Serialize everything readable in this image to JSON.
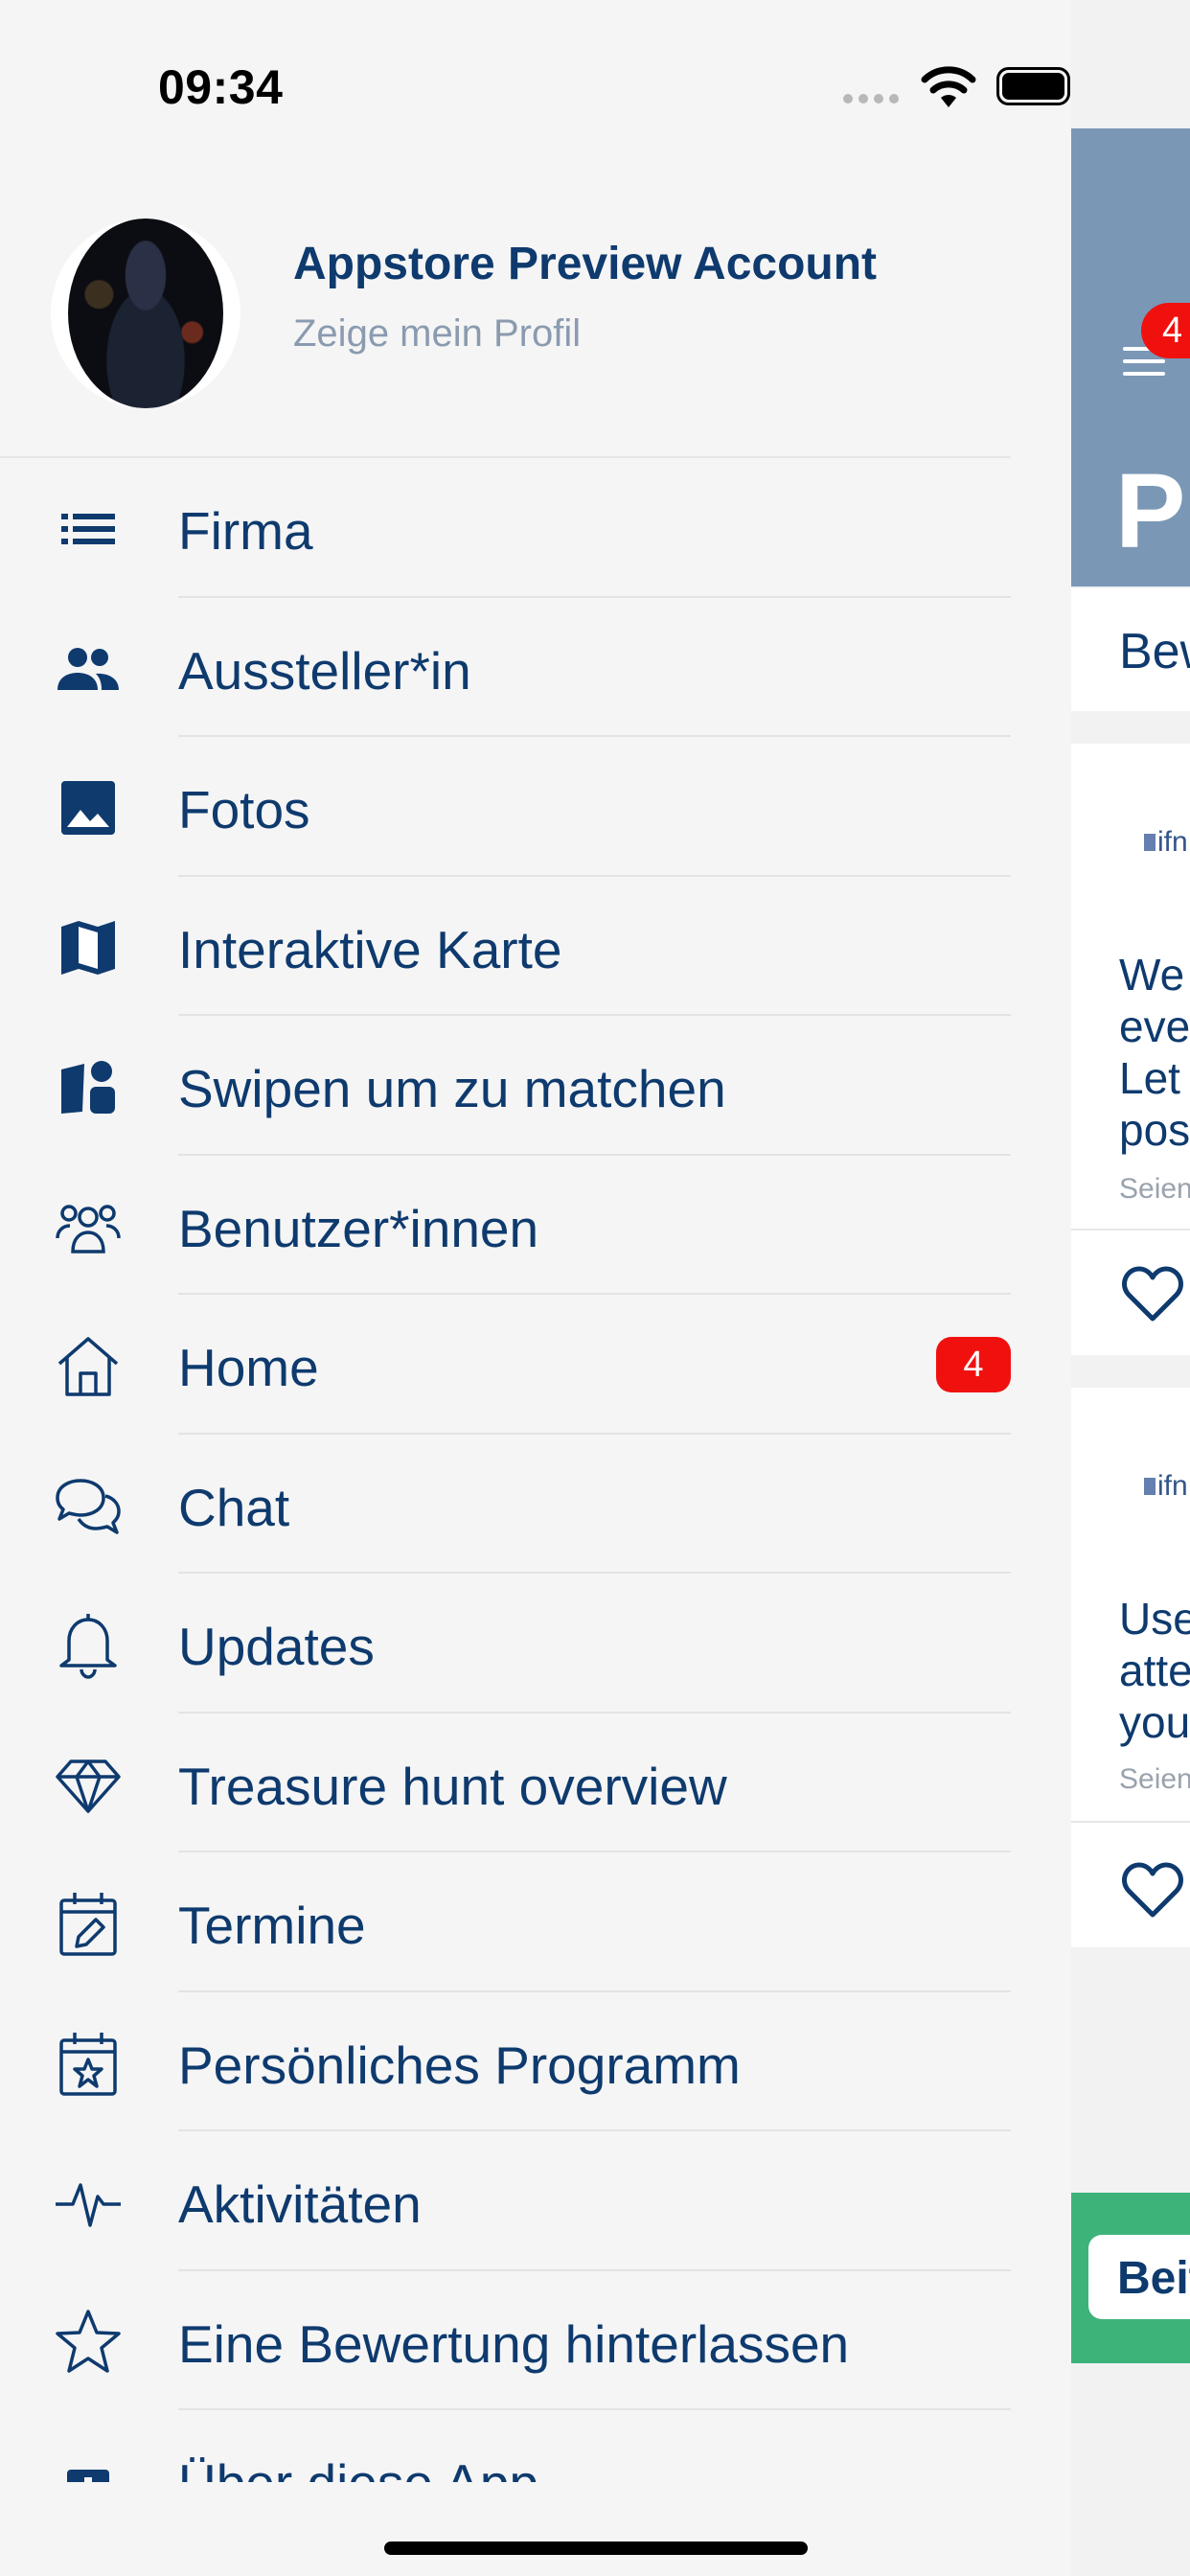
{
  "status_bar": {
    "time": "09:34"
  },
  "drawer": {
    "user_name": "Appstore Preview Account",
    "profile_link": "Zeige mein Profil",
    "items": [
      {
        "label": "Firma",
        "icon": "list-icon"
      },
      {
        "label": "Aussteller*in",
        "icon": "people-icon"
      },
      {
        "label": "Fotos",
        "icon": "photo-icon"
      },
      {
        "label": "Interaktive Karte",
        "icon": "map-icon"
      },
      {
        "label": "Swipen um zu matchen",
        "icon": "swipe-match-icon"
      },
      {
        "label": "Benutzer*innen",
        "icon": "users-icon"
      },
      {
        "label": "Home",
        "icon": "home-icon",
        "badge": "4"
      },
      {
        "label": "Chat",
        "icon": "chat-icon"
      },
      {
        "label": "Updates",
        "icon": "bell-icon"
      },
      {
        "label": "Treasure hunt overview",
        "icon": "diamond-icon"
      },
      {
        "label": "Termine",
        "icon": "calendar-edit-icon"
      },
      {
        "label": "Persönliches Programm",
        "icon": "calendar-star-icon"
      },
      {
        "label": "Aktivitäten",
        "icon": "activity-icon"
      },
      {
        "label": "Eine Bewertung hinterlassen",
        "icon": "star-icon"
      },
      {
        "label": "Über diese App",
        "icon": "info-icon"
      }
    ]
  },
  "main_peek": {
    "header_badge": "4",
    "title": "Pi",
    "tab": "Bew",
    "cards": [
      {
        "logo": "ifn",
        "lines": "We\never\nLet\npos",
        "meta": "Seien"
      },
      {
        "logo": "ifn",
        "lines": "Use\natte\nyou",
        "meta": "Seien"
      }
    ],
    "cta": "Beit"
  },
  "colors": {
    "accent": "#0e3a6e",
    "badge": "#f0110f",
    "header": "#7a97b6",
    "cta": "#3db37a"
  }
}
